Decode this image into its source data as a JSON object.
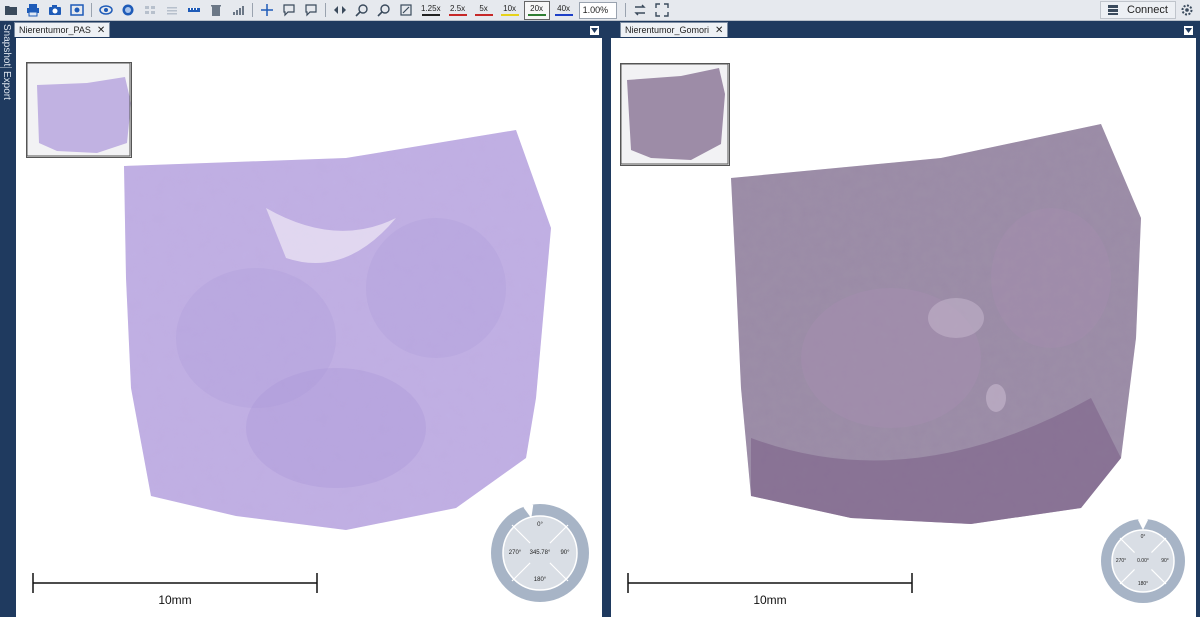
{
  "toolbar": {
    "zoom_levels": [
      {
        "label": "1.25x",
        "color": "#222222"
      },
      {
        "label": "2.5x",
        "color": "#c62828"
      },
      {
        "label": "5x",
        "color": "#c62828"
      },
      {
        "label": "10x",
        "color": "#e6d21a"
      },
      {
        "label": "20x",
        "color": "#2e7d32"
      },
      {
        "label": "40x",
        "color": "#1e40c8"
      }
    ],
    "active_zoom": "20x",
    "zoom_value": "1.00%",
    "connect_label": "Connect"
  },
  "side_tabs": [
    "Snapshot",
    "Export"
  ],
  "viewers": [
    {
      "tab_label": "Nierentumor_PAS",
      "close_label": "✕",
      "scale_label": "10mm",
      "compass": {
        "top": "0°",
        "left": "270°",
        "center": "345.78°",
        "right": "90°",
        "bottom": "180°"
      }
    },
    {
      "tab_label": "Nierentumor_Gomori",
      "close_label": "✕",
      "scale_label": "10mm",
      "compass": {
        "top": "0°",
        "left": "270°",
        "center": "0.00°",
        "right": "90°",
        "bottom": "180°"
      }
    }
  ],
  "colors": {
    "frame": "#1f3a5f",
    "pas_stain": "#b9a6de",
    "gomori_stain": "#8f7a9a"
  }
}
